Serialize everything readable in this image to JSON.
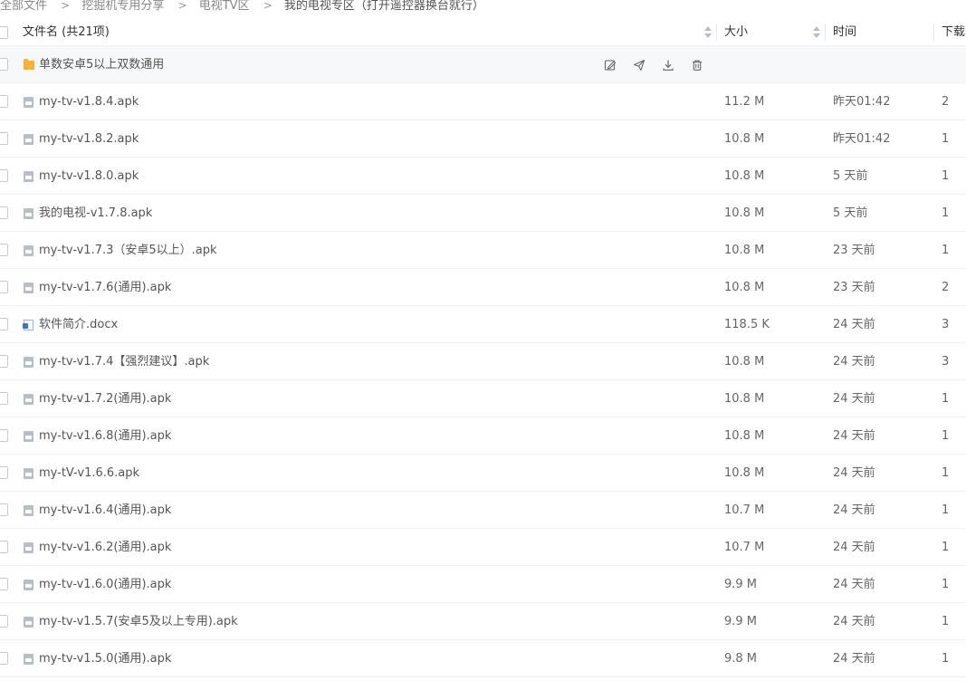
{
  "breadcrumb": {
    "items": [
      "全部文件",
      "挖掘机专用分享",
      "电视TV区",
      "我的电视专区（打开遥控器换台就行）"
    ]
  },
  "header": {
    "name": "文件名 (共21项)",
    "size": "大小",
    "time": "时间",
    "downloads": "下载"
  },
  "colors": {
    "folder": "#f7b13b",
    "apk_icon": "#b9bec6",
    "doc_icon": "#3b73d1"
  },
  "rows": [
    {
      "type": "folder",
      "icon": "folder-icon",
      "name": "单数安卓5以上双数通用",
      "size": "",
      "time": "",
      "downloads": ""
    },
    {
      "type": "file",
      "icon": "apk-icon",
      "name": "my-tv-v1.8.4.apk",
      "size": "11.2 M",
      "time": "昨天01:42",
      "downloads": "2"
    },
    {
      "type": "file",
      "icon": "apk-icon",
      "name": "my-tv-v1.8.2.apk",
      "size": "10.8 M",
      "time": "昨天01:42",
      "downloads": "1"
    },
    {
      "type": "file",
      "icon": "apk-icon",
      "name": "my-tv-v1.8.0.apk",
      "size": "10.8 M",
      "time": "5 天前",
      "downloads": "1"
    },
    {
      "type": "file",
      "icon": "apk-icon",
      "name": "我的电视-v1.7.8.apk",
      "size": "10.8 M",
      "time": "5 天前",
      "downloads": "1"
    },
    {
      "type": "file",
      "icon": "apk-icon",
      "name": "my-tv-v1.7.3（安卓5以上）.apk",
      "size": "10.8 M",
      "time": "23 天前",
      "downloads": "1"
    },
    {
      "type": "file",
      "icon": "apk-icon",
      "name": "my-tv-v1.7.6(通用).apk",
      "size": "10.8 M",
      "time": "23 天前",
      "downloads": "2"
    },
    {
      "type": "file",
      "icon": "doc-icon",
      "name": "软件简介.docx",
      "size": "118.5 K",
      "time": "24 天前",
      "downloads": "3"
    },
    {
      "type": "file",
      "icon": "apk-icon",
      "name": "my-tv-v1.7.4【强烈建议】.apk",
      "size": "10.8 M",
      "time": "24 天前",
      "downloads": "3"
    },
    {
      "type": "file",
      "icon": "apk-icon",
      "name": "my-tv-v1.7.2(通用).apk",
      "size": "10.8 M",
      "time": "24 天前",
      "downloads": "1"
    },
    {
      "type": "file",
      "icon": "apk-icon",
      "name": "my-tv-v1.6.8(通用).apk",
      "size": "10.8 M",
      "time": "24 天前",
      "downloads": "1"
    },
    {
      "type": "file",
      "icon": "apk-icon",
      "name": "my-tV-v1.6.6.apk",
      "size": "10.8 M",
      "time": "24 天前",
      "downloads": "1"
    },
    {
      "type": "file",
      "icon": "apk-icon",
      "name": "my-tv-v1.6.4(通用).apk",
      "size": "10.7 M",
      "time": "24 天前",
      "downloads": "1"
    },
    {
      "type": "file",
      "icon": "apk-icon",
      "name": "my-tv-v1.6.2(通用).apk",
      "size": "10.7 M",
      "time": "24 天前",
      "downloads": "1"
    },
    {
      "type": "file",
      "icon": "apk-icon",
      "name": "my-tv-v1.6.0(通用).apk",
      "size": "9.9 M",
      "time": "24 天前",
      "downloads": "1"
    },
    {
      "type": "file",
      "icon": "apk-icon",
      "name": "my-tv-v1.5.7(安卓5及以上专用).apk",
      "size": "9.9 M",
      "time": "24 天前",
      "downloads": "1"
    },
    {
      "type": "file",
      "icon": "apk-icon",
      "name": "my-tv-v1.5.0(通用).apk",
      "size": "9.8 M",
      "time": "24 天前",
      "downloads": "1"
    }
  ],
  "folder_actions": [
    "edit-icon",
    "share-icon",
    "download-icon",
    "delete-icon"
  ]
}
